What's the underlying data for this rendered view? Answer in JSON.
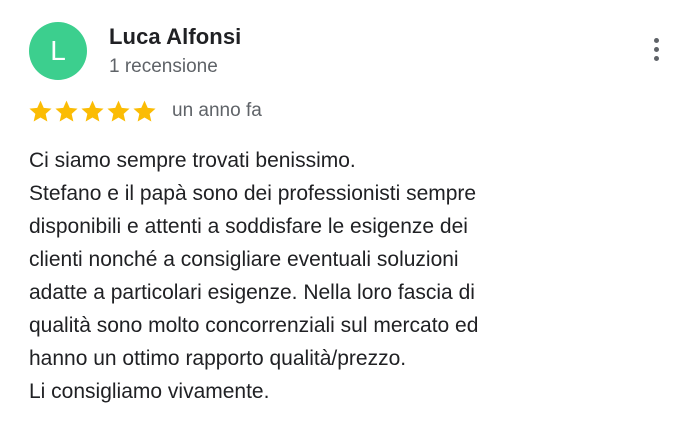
{
  "review": {
    "author": {
      "initial": "L",
      "name": "Luca Alfonsi",
      "review_count": "1 recensione",
      "avatar_color": "#3ccf8e"
    },
    "rating": {
      "stars": 5,
      "max_stars": 5,
      "star_color": "#fbbc04"
    },
    "date": "un anno fa",
    "text_lines": [
      "Ci siamo sempre trovati benissimo.",
      "Stefano e il papà sono dei professionisti sempre",
      "disponibili e attenti a soddisfare le esigenze dei",
      "clienti nonché a consigliare eventuali soluzioni",
      "adatte a particolari esigenze. Nella loro fascia di",
      "qualità sono molto concorrenziali sul mercato ed",
      "hanno un ottimo rapporto qualità/prezzo.",
      "Li consigliamo vivamente."
    ],
    "menu_icon": "more-vertical-icon"
  }
}
